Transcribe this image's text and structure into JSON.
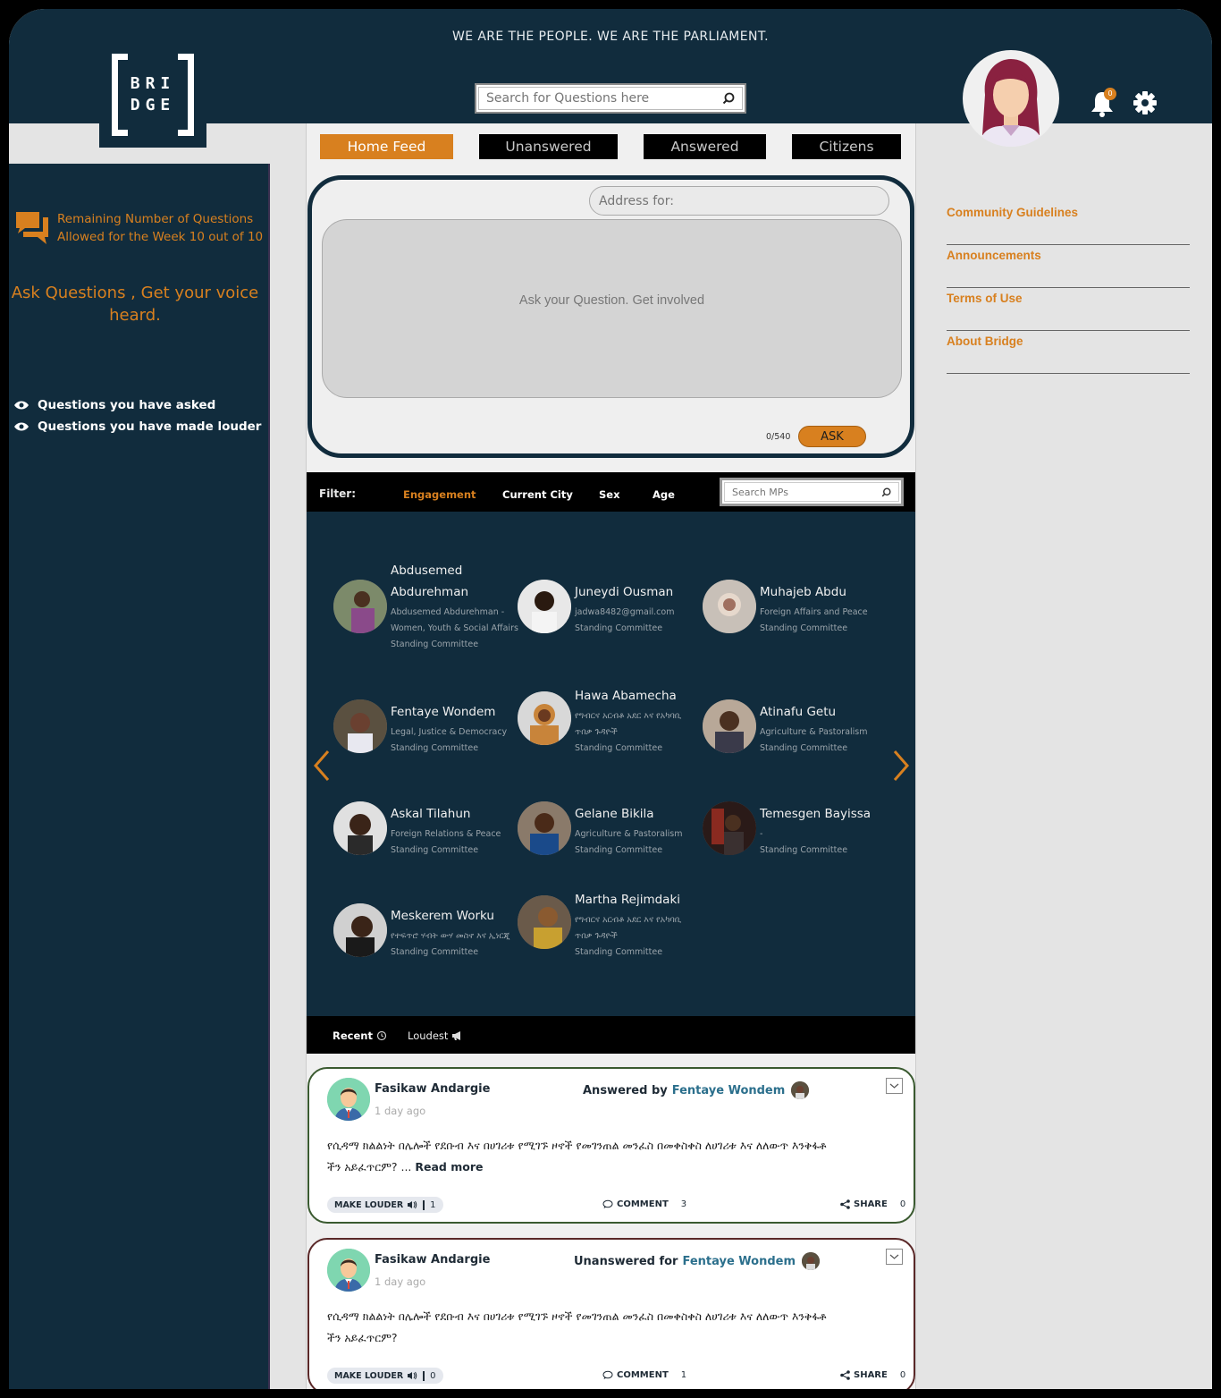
{
  "header": {
    "slogan": "WE ARE THE PEOPLE. WE ARE THE PARLIAMENT.",
    "logo_text": "BRI DGE",
    "search_placeholder": "Search for Questions here",
    "notification_count": "0"
  },
  "tabs": [
    {
      "label": "Home Feed",
      "active": true
    },
    {
      "label": "Unanswered",
      "active": false
    },
    {
      "label": "Answered",
      "active": false
    },
    {
      "label": "Citizens",
      "active": false
    }
  ],
  "sidebar": {
    "remaining_line1": "Remaining Number of Questions",
    "remaining_line2": "Allowed for the Week 10 out of 10",
    "ask_heading_line1": "Ask Questions , Get your voice",
    "ask_heading_line2": "heard.",
    "links": [
      "Questions you have asked",
      "Questions you have made louder"
    ]
  },
  "compose": {
    "address_placeholder": "Address for:",
    "question_placeholder": "Ask your Question. Get involved",
    "counter": "0/540",
    "ask_label": "ASK"
  },
  "filter": {
    "label": "Filter:",
    "items": [
      "Engagement",
      "Current City",
      "Sex",
      "Age"
    ],
    "active": "Engagement",
    "search_placeholder": "Search MPs"
  },
  "mps": [
    {
      "name1": "Abdusemed",
      "name2": "Abdurehman",
      "sub1": "Abdusemed Abdurehman -",
      "sub2": "Women, Youth & Social Affairs",
      "sub3": "Standing Committee"
    },
    {
      "name1": "Juneydi Ousman",
      "sub1": "jadwa8482@gmail.com",
      "sub2": "Standing Committee"
    },
    {
      "name1": "Muhajeb Abdu",
      "sub1": "Foreign Affairs and Peace",
      "sub2": "Standing Committee"
    },
    {
      "name1": "Fentaye Wondem",
      "sub1": "Legal, Justice & Democracy",
      "sub2": "Standing Committee"
    },
    {
      "name1": "Hawa Abamecha",
      "sub1": "የግብርና አርብቶ አደር እና የአካባቢ",
      "sub2": "ጥበቃ ጉዳዮች",
      "sub3": "Standing Committee"
    },
    {
      "name1": "Atinafu Getu",
      "sub1": "Agriculture & Pastoralism",
      "sub2": "Standing Committee"
    },
    {
      "name1": "Askal Tilahun",
      "sub1": "Foreign Relations & Peace",
      "sub2": "Standing Committee"
    },
    {
      "name1": "Gelane Bikila",
      "sub1": "Agriculture & Pastoralism",
      "sub2": "Standing Committee"
    },
    {
      "name1": "Temesgen Bayissa",
      "sub1": "-",
      "sub2": "Standing Committee"
    },
    {
      "name1": "Meskerem Worku",
      "sub1": "የተፍጥሮ ሃብት ውሃ መስኖ እና ኢነርጂ",
      "sub2": "Standing Committee"
    },
    {
      "name1": "Martha Rejimdaki",
      "sub1": "የግብርና አርብቶ አደር እና የአካባቢ",
      "sub2": "ጥበቃ ጉዳዮች",
      "sub3": "Standing Committee"
    }
  ],
  "sort": {
    "recent": "Recent",
    "loudest": "Loudest"
  },
  "posts": [
    {
      "asker": "Fasikaw Andargie",
      "ago": "1 day ago",
      "status": "Answered by",
      "mp": "Fentaye Wondem",
      "body_line1": "የሲዳማ ክልልነት በሌሎች የደቡብ እና በሀገሪቱ የሚገኙ ዞኖች የመገንጠል መንፈስ በመቀስቀስ ለሀገሪቱ እና ለለውጥ እንቅፋቶ",
      "body_line2": "ችን አይፈጥርም? ...",
      "read_more": "Read more",
      "louder_label": "MAKE LOUDER",
      "louder_count": "1",
      "comment_label": "COMMENT",
      "comment_count": "3",
      "share_label": "SHARE",
      "share_count": "0"
    },
    {
      "asker": "Fasikaw Andargie",
      "ago": "1 day ago",
      "status": "Unanswered for",
      "mp": "Fentaye Wondem",
      "body_line1": "የሲዳማ ክልልነት በሌሎች የደቡብ እና በሀገሪቱ የሚገኙ ዞኖች የመገንጠል መንፈስ በመቀስቀስ ለሀገሪቱ እና ለለውጥ እንቅፋቶ",
      "body_line2": "ችን አይፈጥርም?",
      "louder_label": "MAKE LOUDER",
      "louder_count": "0",
      "comment_label": "COMMENT",
      "comment_count": "1",
      "share_label": "SHARE",
      "share_count": "0"
    }
  ],
  "right_links": [
    "Community Guidelines",
    "Announcements",
    "Terms of Use",
    "About Bridge"
  ],
  "colors": {
    "navy": "#112c3d",
    "accent": "#d8801f",
    "mp_link": "#2b6f8c"
  }
}
